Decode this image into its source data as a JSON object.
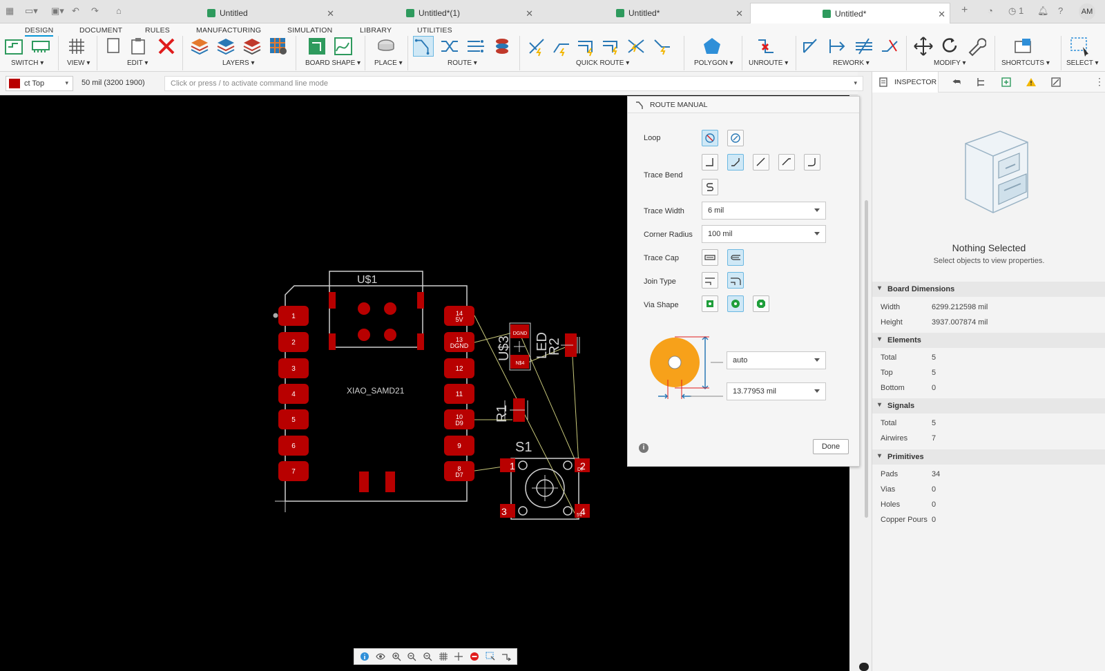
{
  "tabs": [
    {
      "label": "Untitled",
      "active": false
    },
    {
      "label": "Untitled*(1)",
      "active": false
    },
    {
      "label": "Untitled*",
      "active": false
    },
    {
      "label": "Untitled*",
      "active": true
    }
  ],
  "topright": {
    "count": "1",
    "user": "AM"
  },
  "workspace_tabs": [
    "DESIGN",
    "DOCUMENT",
    "RULES",
    "MANUFACTURING",
    "SIMULATION",
    "LIBRARY",
    "UTILITIES"
  ],
  "tool_groups": {
    "switch": "SWITCH",
    "view": "VIEW",
    "edit": "EDIT",
    "layers": "LAYERS",
    "board_shape": "BOARD SHAPE",
    "place": "PLACE",
    "route": "ROUTE",
    "quick_route": "QUICK ROUTE",
    "polygon": "POLYGON",
    "unroute": "UNROUTE",
    "rework": "REWORK",
    "modify": "MODIFY",
    "shortcuts": "SHORTCUTS",
    "select": "SELECT"
  },
  "cmdbar": {
    "layer": "ct Top",
    "layer_color": "#b80000",
    "grid": "50 mil (3200 1900)",
    "placeholder": "Click or press / to activate command line mode"
  },
  "board": {
    "u1_label": "U$1",
    "module_name": "XIAO_SAMD21",
    "left_pins": [
      "1",
      "2",
      "3",
      "4",
      "5",
      "6",
      "7"
    ],
    "right_pins": [
      {
        "num": "14",
        "sig": "5V"
      },
      {
        "num": "13",
        "sig": "DGND"
      },
      {
        "num": "12",
        "sig": ""
      },
      {
        "num": "11",
        "sig": ""
      },
      {
        "num": "10",
        "sig": "D9"
      },
      {
        "num": "9",
        "sig": ""
      },
      {
        "num": "8",
        "sig": "D7"
      }
    ],
    "u3_label": "U$3",
    "led_label": "LED",
    "r2_label": "R2",
    "r1_label": "R1",
    "s1_label": "S1",
    "u3_pad_top": "DGND",
    "u3_pad_bot": "N$4",
    "s1_pins": [
      "1",
      "2",
      "3",
      "4"
    ],
    "s1_pin2_sig": "D7",
    "s1_pin4_sig": "5V"
  },
  "route_manual": {
    "title": "ROUTE MANUAL",
    "loop_label": "Loop",
    "trace_bend_label": "Trace Bend",
    "trace_width_label": "Trace Width",
    "trace_width_value": "6 mil",
    "corner_radius_label": "Corner Radius",
    "corner_radius_value": "100 mil",
    "trace_cap_label": "Trace Cap",
    "join_type_label": "Join Type",
    "via_shape_label": "Via Shape",
    "via_diameter_value": "auto",
    "via_drill_value": "13.77953 mil",
    "done_label": "Done"
  },
  "inspector": {
    "title": "INSPECTOR",
    "nothing_selected": "Nothing Selected",
    "hint": "Select objects to view properties.",
    "sections": [
      {
        "title": "Board Dimensions",
        "rows": [
          [
            "Width",
            "6299.212598 mil"
          ],
          [
            "Height",
            "3937.007874 mil"
          ]
        ]
      },
      {
        "title": "Elements",
        "rows": [
          [
            "Total",
            "5"
          ],
          [
            "Top",
            "5"
          ],
          [
            "Bottom",
            "0"
          ]
        ]
      },
      {
        "title": "Signals",
        "rows": [
          [
            "Total",
            "5"
          ],
          [
            "Airwires",
            "7"
          ]
        ]
      },
      {
        "title": "Primitives",
        "rows": [
          [
            "Pads",
            "34"
          ],
          [
            "Vias",
            "0"
          ],
          [
            "Holes",
            "0"
          ],
          [
            "Copper Pours",
            "0"
          ]
        ]
      }
    ]
  }
}
